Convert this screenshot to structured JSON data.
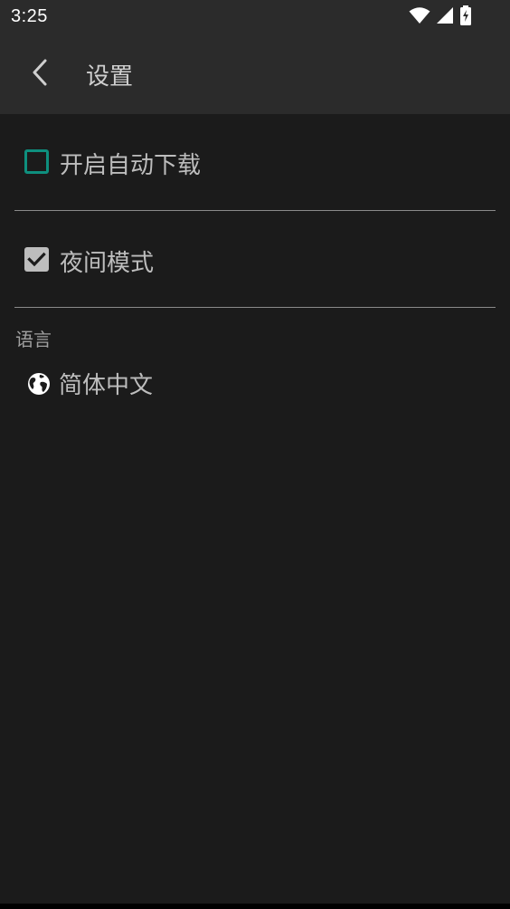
{
  "status_bar": {
    "time": "3:25",
    "icons": [
      "wifi-icon",
      "cell-signal-icon",
      "battery-charging-icon"
    ]
  },
  "app_bar": {
    "title": "设置",
    "back_icon": "chevron-left-icon"
  },
  "settings": {
    "auto_download": {
      "label": "开启自动下载",
      "checked": false
    },
    "night_mode": {
      "label": "夜间模式",
      "checked": true
    }
  },
  "language_section": {
    "header": "语言",
    "item": {
      "label": "简体中文",
      "icon": "globe-icon"
    }
  },
  "colors": {
    "background": "#1b1b1b",
    "app_bar": "#2b2b2b",
    "accent": "#0e8f7e",
    "text": "#bdbdbd"
  }
}
